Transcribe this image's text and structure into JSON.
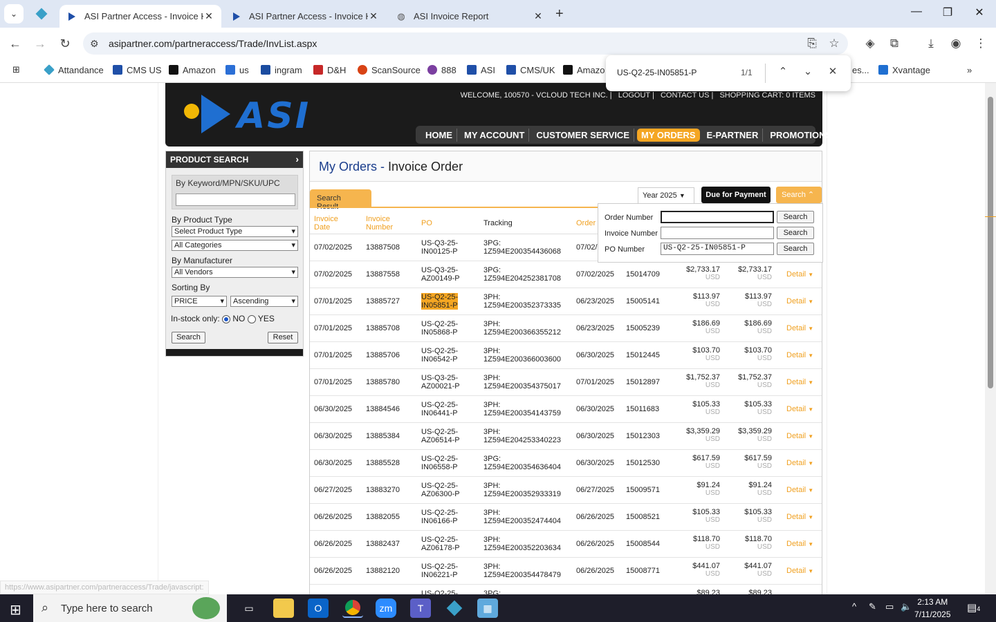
{
  "browser": {
    "tabs": [
      {
        "title": "ASI Partner Access - Invoice His"
      },
      {
        "title": "ASI Partner Access - Invoice His"
      },
      {
        "title": "ASI Invoice Report"
      }
    ],
    "url": "asipartner.com/partneraccess/Trade/InvList.aspx",
    "bookmarks": [
      "Attandance",
      "CMS US",
      "Amazon",
      "us",
      "ingram",
      "D&H",
      "ScanSource",
      "888",
      "ASI",
      "CMS/UK",
      "Amazo",
      "es...",
      "Xvantage"
    ],
    "find": {
      "query": "US-Q2-25-IN05851-P",
      "count": "1/1"
    }
  },
  "site": {
    "logo": "ASI",
    "toplinks": [
      "WELCOME, 100570 - VCLOUD TECH INC.",
      "LOGOUT",
      "CONTACT US",
      "SHOPPING CART: 0 ITEMS"
    ],
    "nav": [
      "HOME",
      "MY ACCOUNT",
      "CUSTOMER SERVICE",
      "MY ORDERS",
      "E-PARTNER",
      "PROMOTIONS"
    ]
  },
  "product_search": {
    "title": "PRODUCT SEARCH",
    "keyword_label": "By Keyword/MPN/SKU/UPC",
    "product_type_label": "By Product Type",
    "product_type_value": "Select Product Type",
    "category_value": "All Categories",
    "manufacturer_label": "By Manufacturer",
    "manufacturer_value": "All Vendors",
    "sorting_label": "Sorting By",
    "sort_field": "PRICE",
    "sort_order": "Ascending",
    "instock_label": "In-stock only:",
    "no_label": "NO",
    "yes_label": "YES",
    "search_btn": "Search",
    "reset_btn": "Reset"
  },
  "content": {
    "breadcrumb_link": "My Orders",
    "dash": " - ",
    "title": "Invoice Order",
    "search_result_tab": "Search Result",
    "year": "Year 2025",
    "due_btn": "Due for Payment",
    "search_toggle": "Search",
    "headers": {
      "invoice_date": "Invoice Date",
      "invoice_number": "Invoice Number",
      "po": "PO",
      "tracking": "Tracking",
      "order": "Order"
    },
    "search_panel": {
      "order_label": "Order Number",
      "invoice_label": "Invoice Number",
      "po_label": "PO Number",
      "po_value": "US-Q2-25-IN05851-P",
      "btn": "Search"
    },
    "rows": [
      {
        "date": "07/02/2025",
        "inv": "13887508",
        "po1": "US-Q3-25-",
        "po2": "IN00125-P",
        "tr1": "3PG:",
        "tr2": "1Z594E200354436068",
        "odate": "07/02/",
        "ord": "",
        "amt1": "",
        "amt2": ""
      },
      {
        "date": "07/02/2025",
        "inv": "13887558",
        "po1": "US-Q3-25-",
        "po2": "AZ00149-P",
        "tr1": "3PG:",
        "tr2": "1Z594E204252381708",
        "odate": "07/02/2025",
        "ord": "15014709",
        "amt1": "$2,733.17",
        "amt2": "$2,733.17"
      },
      {
        "date": "07/01/2025",
        "inv": "13885727",
        "po1": "US-Q2-25-",
        "po2": "IN05851-P",
        "tr1": "3PH:",
        "tr2": "1Z594E200352373335",
        "odate": "06/23/2025",
        "ord": "15005141",
        "amt1": "$113.97",
        "amt2": "$113.97",
        "hl": true
      },
      {
        "date": "07/01/2025",
        "inv": "13885708",
        "po1": "US-Q2-25-",
        "po2": "IN05868-P",
        "tr1": "3PH:",
        "tr2": "1Z594E200366355212",
        "odate": "06/23/2025",
        "ord": "15005239",
        "amt1": "$186.69",
        "amt2": "$186.69"
      },
      {
        "date": "07/01/2025",
        "inv": "13885706",
        "po1": "US-Q2-25-",
        "po2": "IN06542-P",
        "tr1": "3PH:",
        "tr2": "1Z594E200366003600",
        "odate": "06/30/2025",
        "ord": "15012445",
        "amt1": "$103.70",
        "amt2": "$103.70"
      },
      {
        "date": "07/01/2025",
        "inv": "13885780",
        "po1": "US-Q3-25-",
        "po2": "AZ00021-P",
        "tr1": "3PH:",
        "tr2": "1Z594E200354375017",
        "odate": "07/01/2025",
        "ord": "15012897",
        "amt1": "$1,752.37",
        "amt2": "$1,752.37"
      },
      {
        "date": "06/30/2025",
        "inv": "13884546",
        "po1": "US-Q2-25-",
        "po2": "IN06441-P",
        "tr1": "3PH:",
        "tr2": "1Z594E200354143759",
        "odate": "06/30/2025",
        "ord": "15011683",
        "amt1": "$105.33",
        "amt2": "$105.33"
      },
      {
        "date": "06/30/2025",
        "inv": "13885384",
        "po1": "US-Q2-25-",
        "po2": "AZ06514-P",
        "tr1": "3PH:",
        "tr2": "1Z594E204253340223",
        "odate": "06/30/2025",
        "ord": "15012303",
        "amt1": "$3,359.29",
        "amt2": "$3,359.29"
      },
      {
        "date": "06/30/2025",
        "inv": "13885528",
        "po1": "US-Q2-25-",
        "po2": "IN06558-P",
        "tr1": "3PG:",
        "tr2": "1Z594E200354636404",
        "odate": "06/30/2025",
        "ord": "15012530",
        "amt1": "$617.59",
        "amt2": "$617.59"
      },
      {
        "date": "06/27/2025",
        "inv": "13883270",
        "po1": "US-Q2-25-",
        "po2": "AZ06300-P",
        "tr1": "3PH:",
        "tr2": "1Z594E200352933319",
        "odate": "06/27/2025",
        "ord": "15009571",
        "amt1": "$91.24",
        "amt2": "$91.24"
      },
      {
        "date": "06/26/2025",
        "inv": "13882055",
        "po1": "US-Q2-25-",
        "po2": "IN06166-P",
        "tr1": "3PH:",
        "tr2": "1Z594E200352474404",
        "odate": "06/26/2025",
        "ord": "15008521",
        "amt1": "$105.33",
        "amt2": "$105.33"
      },
      {
        "date": "06/26/2025",
        "inv": "13882437",
        "po1": "US-Q2-25-",
        "po2": "AZ06178-P",
        "tr1": "3PH:",
        "tr2": "1Z594E200352203634",
        "odate": "06/26/2025",
        "ord": "15008544",
        "amt1": "$118.70",
        "amt2": "$118.70"
      },
      {
        "date": "06/26/2025",
        "inv": "13882120",
        "po1": "US-Q2-25-",
        "po2": "IN06221-P",
        "tr1": "3PH:",
        "tr2": "1Z594E200354478479",
        "odate": "06/26/2025",
        "ord": "15008771",
        "amt1": "$441.07",
        "amt2": "$441.07"
      },
      {
        "date": "",
        "inv": "",
        "po1": "US-Q2-25-",
        "po2": "",
        "tr1": "3PG:",
        "tr2": "",
        "odate": "",
        "ord": "",
        "amt1": "$89.23",
        "amt2": "$89.23"
      }
    ],
    "currency": "USD",
    "detail": "Detail"
  },
  "status_url": "https://www.asipartner.com/partneraccess/Trade/javascript:",
  "taskbar": {
    "search_placeholder": "Type here to search",
    "time": "2:13 AM",
    "date": "7/11/2025",
    "notif": "4"
  }
}
